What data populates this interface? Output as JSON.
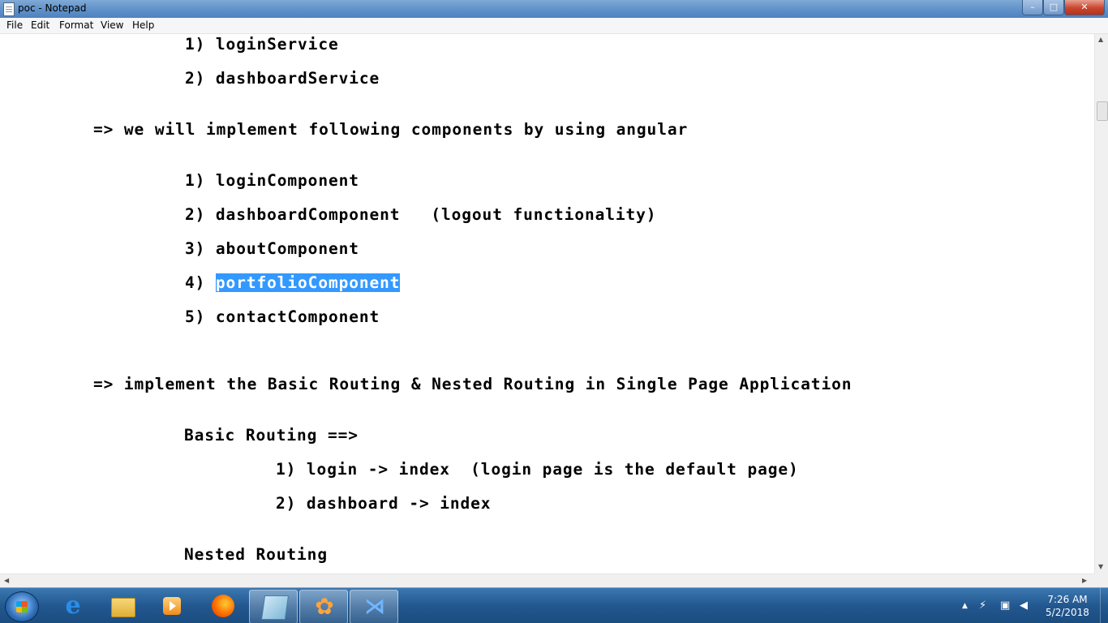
{
  "window": {
    "title": "poc - Notepad",
    "controls": {
      "minimize": "–",
      "maximize": "□",
      "close": "✕"
    }
  },
  "menu": [
    "File",
    "Edit",
    "Format",
    "View",
    "Help"
  ],
  "editor": {
    "lines": [
      "1) loginService",
      "2) dashboardService",
      "=> we will implement following components by using angular",
      "1) loginComponent",
      "2) dashboardComponent   (logout functionality)",
      "3) aboutComponent",
      "4) ",
      "portfolioComponent",
      "5) contactComponent",
      "=> implement the Basic Routing & Nested Routing in Single Page Application",
      "Basic Routing ==>",
      "1) login -> index  (login page is the default page)",
      "2) dashboard -> index",
      "Nested Routing"
    ],
    "selected_text": "portfolioComponent"
  },
  "scrollbars": {
    "up": "▲",
    "down": "▼",
    "left": "◀",
    "right": "▶"
  },
  "taskbar": {
    "apps": [
      "start-orb",
      "internet-explorer",
      "file-explorer",
      "media-player",
      "firefox",
      "notepad",
      "app-flower",
      "visual-studio-code"
    ],
    "tray_icons": [
      "▲",
      "⚡",
      "▣",
      "◀"
    ],
    "time": "7:26 AM",
    "date": "5/2/2018"
  },
  "colors": {
    "selection": "#3399ff",
    "taskbar": "#22578f",
    "close_button": "#c9452d"
  }
}
